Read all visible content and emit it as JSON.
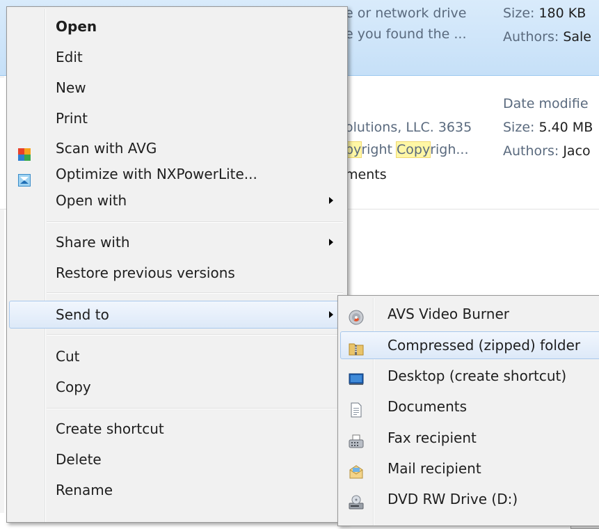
{
  "background": {
    "result1": {
      "snippet_line1": "e or network drive",
      "snippet_line2": "e you found the ...",
      "size_label": "Size:",
      "size_value": "180 KB",
      "authors_label": "Authors:",
      "authors_value": "Sale"
    },
    "result2": {
      "date_label": "Date modifie",
      "snippet_line1": "olutions, LLC. 3635",
      "snippet_part_a": "py",
      "snippet_part_b": "right ",
      "snippet_part_c": "Copy",
      "snippet_part_d": "righ...",
      "snippet_line3": "ments",
      "size_label": "Size:",
      "size_value": "5.40 MB",
      "authors_label": "Authors:",
      "authors_value": "Jaco"
    }
  },
  "context_menu": {
    "items": [
      {
        "label": "Open"
      },
      {
        "label": "Edit"
      },
      {
        "label": "New"
      },
      {
        "label": "Print"
      },
      {
        "label": "Scan with AVG",
        "icon": "avg-icon"
      },
      {
        "label": "Optimize with NXPowerLite...",
        "icon": "nxpowerlite-icon"
      },
      {
        "label": "Open with"
      },
      {
        "label": "Share with"
      },
      {
        "label": "Restore previous versions"
      },
      {
        "label": "Send to"
      },
      {
        "label": "Cut"
      },
      {
        "label": "Copy"
      },
      {
        "label": "Create shortcut"
      },
      {
        "label": "Delete"
      },
      {
        "label": "Rename"
      }
    ]
  },
  "send_to_menu": {
    "items": [
      {
        "label": "AVS Video Burner",
        "icon": "disc-burner-icon"
      },
      {
        "label": "Compressed (zipped) folder",
        "icon": "zip-folder-icon"
      },
      {
        "label": "Desktop (create shortcut)",
        "icon": "desktop-icon"
      },
      {
        "label": "Documents",
        "icon": "documents-icon"
      },
      {
        "label": "Fax recipient",
        "icon": "fax-icon"
      },
      {
        "label": "Mail recipient",
        "icon": "mail-icon"
      },
      {
        "label": "DVD RW Drive (D:)",
        "icon": "dvd-drive-icon"
      }
    ]
  },
  "colors": {
    "selection_fill": "#dde9f8",
    "selection_border": "#a8c8ec",
    "menu_background": "#f1f1f1",
    "highlight": "#fff7a6"
  }
}
